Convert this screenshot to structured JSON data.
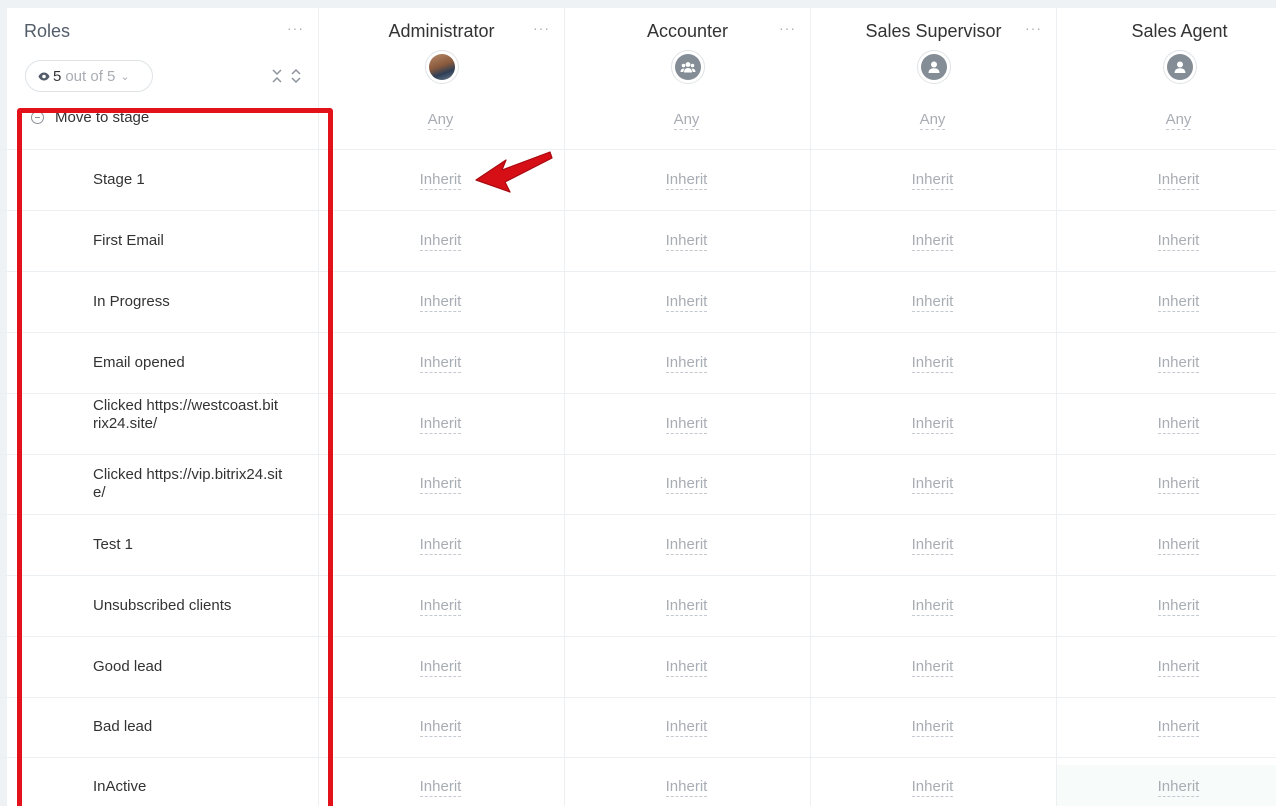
{
  "roles_column": {
    "title": "Roles",
    "counter": {
      "shown": "5",
      "of_label": "out of 5"
    }
  },
  "roles": [
    {
      "name": "Administrator",
      "avatar": "photo"
    },
    {
      "name": "Accounter",
      "avatar": "group-icon"
    },
    {
      "name": "Sales Supervisor",
      "avatar": "user-icon"
    },
    {
      "name": "Sales Agent",
      "avatar": "user-icon"
    }
  ],
  "group": {
    "label": "Move to stage",
    "value": "Any"
  },
  "stages": [
    {
      "label": "Stage 1",
      "value": "Inherit"
    },
    {
      "label": "First Email",
      "value": "Inherit"
    },
    {
      "label": "In Progress",
      "value": "Inherit"
    },
    {
      "label": "Email opened",
      "value": "Inherit"
    },
    {
      "label": "Clicked https://westcoast.bitrix24.site/",
      "value": "Inherit"
    },
    {
      "label": "Clicked https://vip.bitrix24.site/",
      "value": "Inherit"
    },
    {
      "label": "Test 1",
      "value": "Inherit"
    },
    {
      "label": "Unsubscribed clients",
      "value": "Inherit"
    },
    {
      "label": "Good lead",
      "value": "Inherit"
    },
    {
      "label": "Bad lead",
      "value": "Inherit"
    },
    {
      "label": "InActive",
      "value": "Inherit"
    }
  ],
  "menu_dots": "···",
  "colors": {
    "highlight": "#e3111a",
    "link": "#a8adb4"
  }
}
